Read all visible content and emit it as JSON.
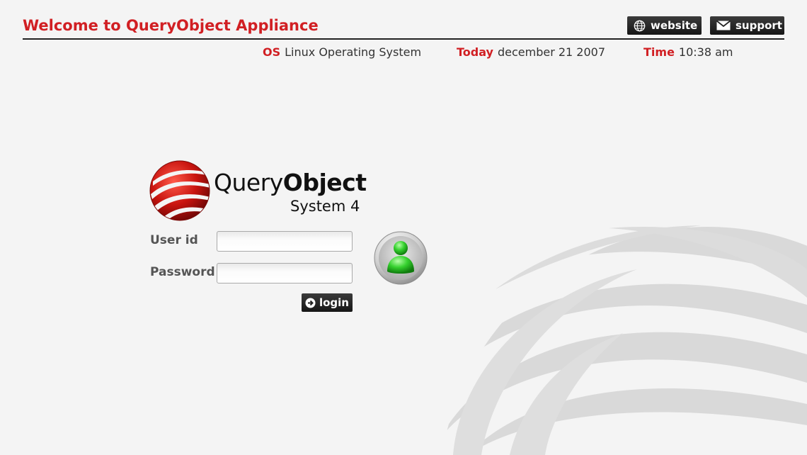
{
  "header": {
    "title": "Welcome to QueryObject Appliance",
    "website_label": "website",
    "support_label": "support",
    "website_icon": "globe-icon",
    "support_icon": "envelope-icon"
  },
  "info": {
    "os_key": "OS",
    "os_value": "Linux Operating System",
    "today_key": "Today",
    "today_value": "december 21 2007",
    "time_key": "Time",
    "time_value": "10:38 am"
  },
  "brand": {
    "name_part1": "Query",
    "name_part2": "Object",
    "subtitle": "System 4"
  },
  "login": {
    "user_label": "User id",
    "user_value": "",
    "password_label": "Password",
    "password_value": "",
    "button_label": "login",
    "button_icon": "arrow-right-circle-icon",
    "avatar_icon": "user-icon"
  },
  "colors": {
    "accent": "#d11f23",
    "button_bg": "#222222",
    "background": "#f4f4f4",
    "avatar_green": "#3fd13f"
  }
}
